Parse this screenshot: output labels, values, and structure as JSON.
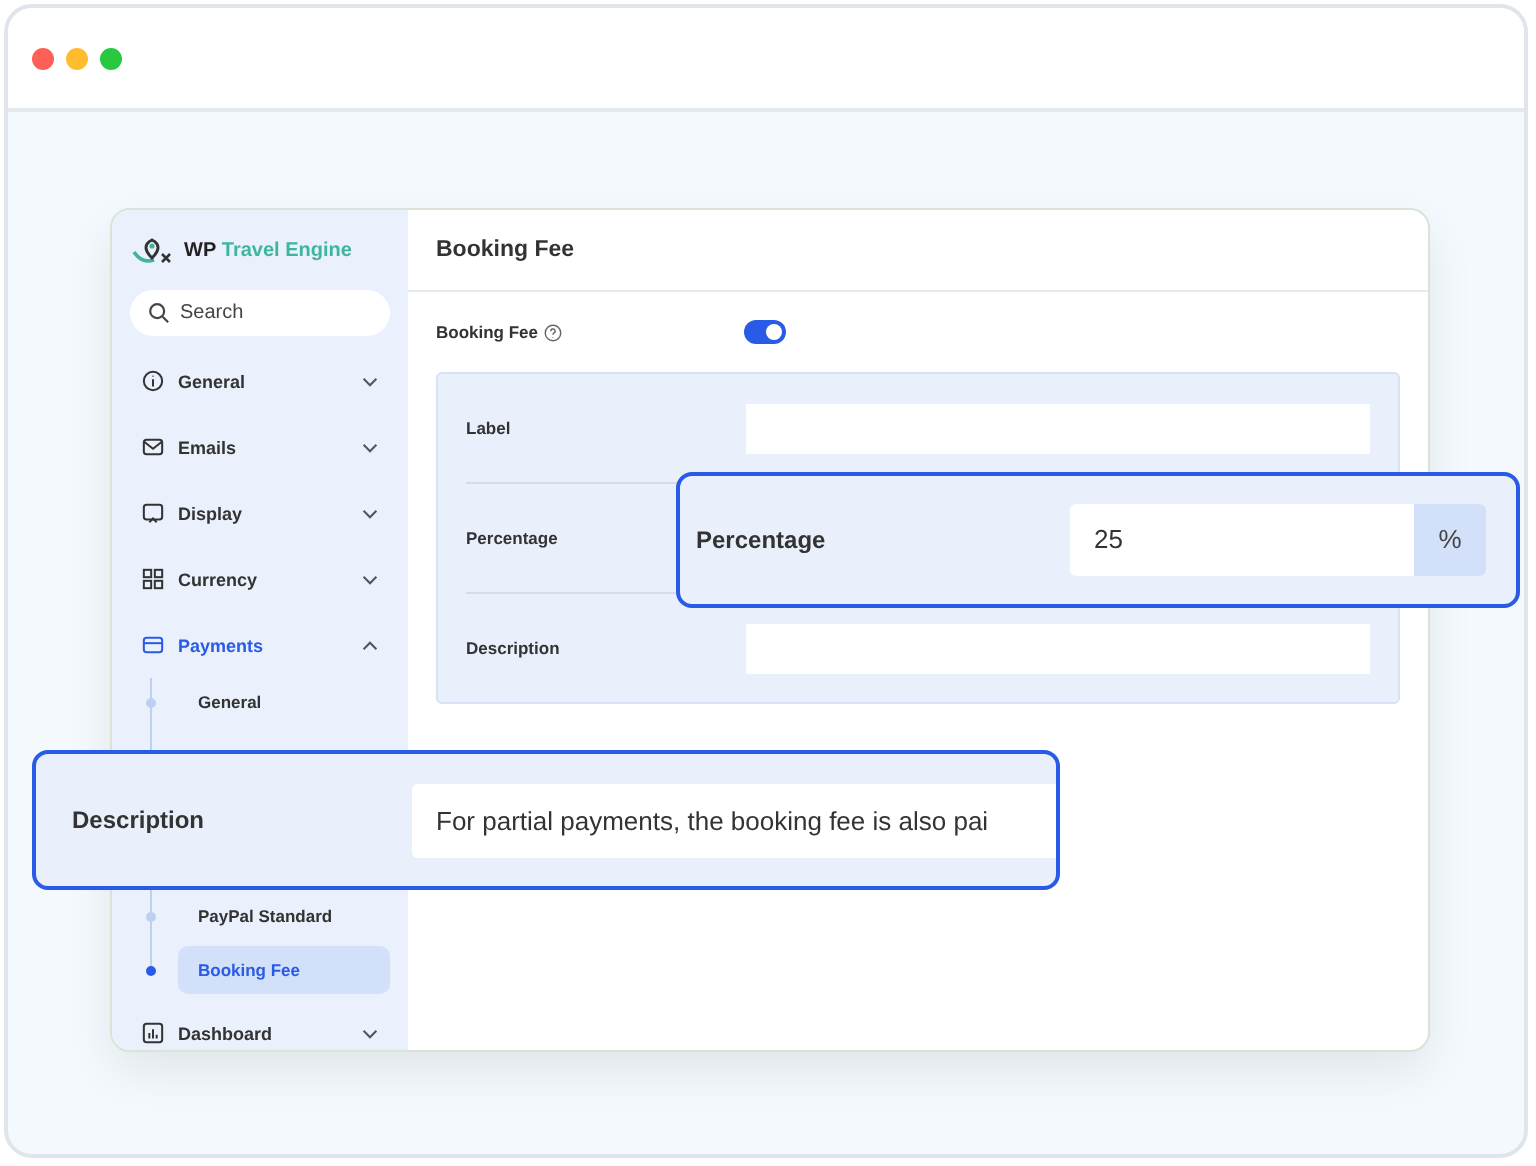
{
  "logo": {
    "prefix": "WP",
    "name": "Travel Engine"
  },
  "search": {
    "placeholder": "Search"
  },
  "sidebar": {
    "items": [
      {
        "label": "General",
        "kind": "info",
        "expanded": false,
        "selected": false
      },
      {
        "label": "Emails",
        "kind": "mail",
        "expanded": false,
        "selected": false
      },
      {
        "label": "Display",
        "kind": "display",
        "expanded": false,
        "selected": false
      },
      {
        "label": "Currency",
        "kind": "grid",
        "expanded": false,
        "selected": false
      },
      {
        "label": "Payments",
        "kind": "card",
        "expanded": true,
        "selected": true,
        "children": [
          {
            "label": "General",
            "selected": false
          },
          {
            "label": "PayPal Standard",
            "selected": false
          },
          {
            "label": "Booking Fee",
            "selected": true
          }
        ]
      },
      {
        "label": "Dashboard",
        "kind": "chart",
        "expanded": false,
        "selected": false
      }
    ]
  },
  "page": {
    "title": "Booking Fee",
    "toggle": {
      "label": "Booking Fee",
      "on": true
    },
    "rows": [
      {
        "label": "Label"
      },
      {
        "label": "Percentage"
      },
      {
        "label": "Description"
      }
    ]
  },
  "callouts": [
    {
      "kind": "percentage",
      "label": "Percentage",
      "value": "25",
      "suffix": "%"
    },
    {
      "kind": "description",
      "label": "Description",
      "value": "For partial payments, the booking fee is also pai"
    }
  ]
}
